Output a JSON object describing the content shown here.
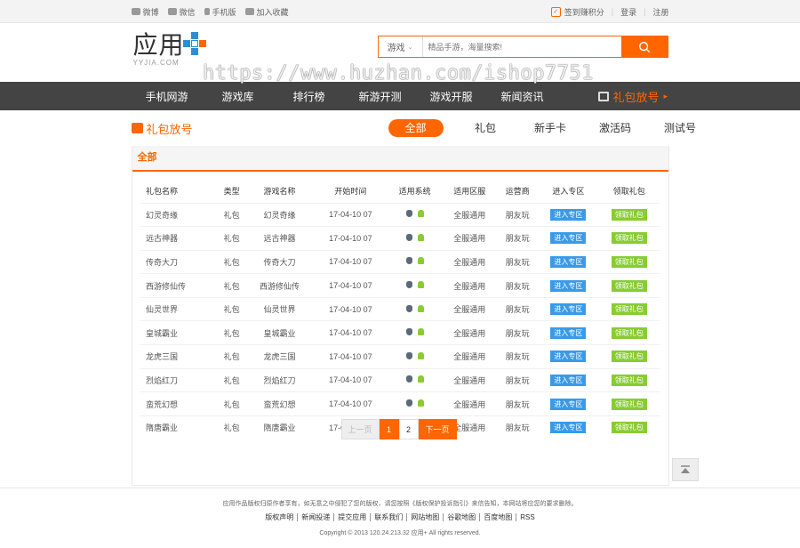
{
  "topbar": {
    "left": [
      "微博",
      "微信",
      "手机版",
      "加入收藏"
    ],
    "sign": "签到赚积分",
    "login": "登录",
    "sep": "|",
    "register": "注册"
  },
  "header": {
    "logo_text": "应用",
    "logo_sub": "YYJIA.COM",
    "search_category": "游戏",
    "search_placeholder": "精品手游，海量搜索!"
  },
  "watermark": "https://www.huzhan.com/ishop7751",
  "nav": {
    "items": [
      "手机网游",
      "游戏库",
      "排行榜",
      "新游开测",
      "游戏开服",
      "新闻资讯"
    ],
    "gift": "礼包放号"
  },
  "section": {
    "title": "礼包放号",
    "tabs": [
      "全部",
      "礼包",
      "新手卡",
      "激活码",
      "测试号"
    ],
    "panel_title": "全部"
  },
  "table": {
    "headers": [
      "礼包名称",
      "类型",
      "游戏名称",
      "开始时间",
      "适用系统",
      "适用区服",
      "运营商",
      "进入专区",
      "领取礼包"
    ],
    "rows": [
      [
        "幻灵奇缘",
        "礼包",
        "幻灵奇缘",
        "17-04-10 07",
        "全服通用",
        "朋友玩"
      ],
      [
        "远古神器",
        "礼包",
        "远古神器",
        "17-04-10 07",
        "全服通用",
        "朋友玩"
      ],
      [
        "传奇大刀",
        "礼包",
        "传奇大刀",
        "17-04-10 07",
        "全服通用",
        "朋友玩"
      ],
      [
        "西游修仙传",
        "礼包",
        "西游修仙传",
        "17-04-10 07",
        "全服通用",
        "朋友玩"
      ],
      [
        "仙灵世界",
        "礼包",
        "仙灵世界",
        "17-04-10 07",
        "全服通用",
        "朋友玩"
      ],
      [
        "皇城霸业",
        "礼包",
        "皇城霸业",
        "17-04-10 07",
        "全服通用",
        "朋友玩"
      ],
      [
        "龙虎三国",
        "礼包",
        "龙虎三国",
        "17-04-10 07",
        "全服通用",
        "朋友玩"
      ],
      [
        "烈焰红刀",
        "礼包",
        "烈焰红刀",
        "17-04-10 07",
        "全服通用",
        "朋友玩"
      ],
      [
        "蛮荒幻想",
        "礼包",
        "蛮荒幻想",
        "17-04-10 07",
        "全服通用",
        "朋友玩"
      ],
      [
        "隋唐霸业",
        "礼包",
        "隋唐霸业",
        "17-04-10 07",
        "全服通用",
        "朋友玩"
      ]
    ],
    "enter_label": "进入专区",
    "get_label": "领取礼包"
  },
  "pager": {
    "prev": "上一页",
    "p1": "1",
    "p2": "2",
    "next": "下一页"
  },
  "footer": {
    "notice": "应用作品版权归原作者享有，如无意之中侵犯了您的版权，请您按照《版权保护投诉指引》来信告知，本网站将应您的要求删除。",
    "links": [
      "版权声明",
      "新闻投递",
      "提交应用",
      "联系我们",
      "网站地图",
      "谷歌地图",
      "百度地图",
      "RSS"
    ],
    "copyright": "Copyright © 2013  120.24.213.32  应用+  All rights reserved."
  },
  "colors": {
    "accent": "#ff6600",
    "nav_bg": "#444444",
    "blue": "#3a9ae8",
    "green": "#88cc33"
  }
}
